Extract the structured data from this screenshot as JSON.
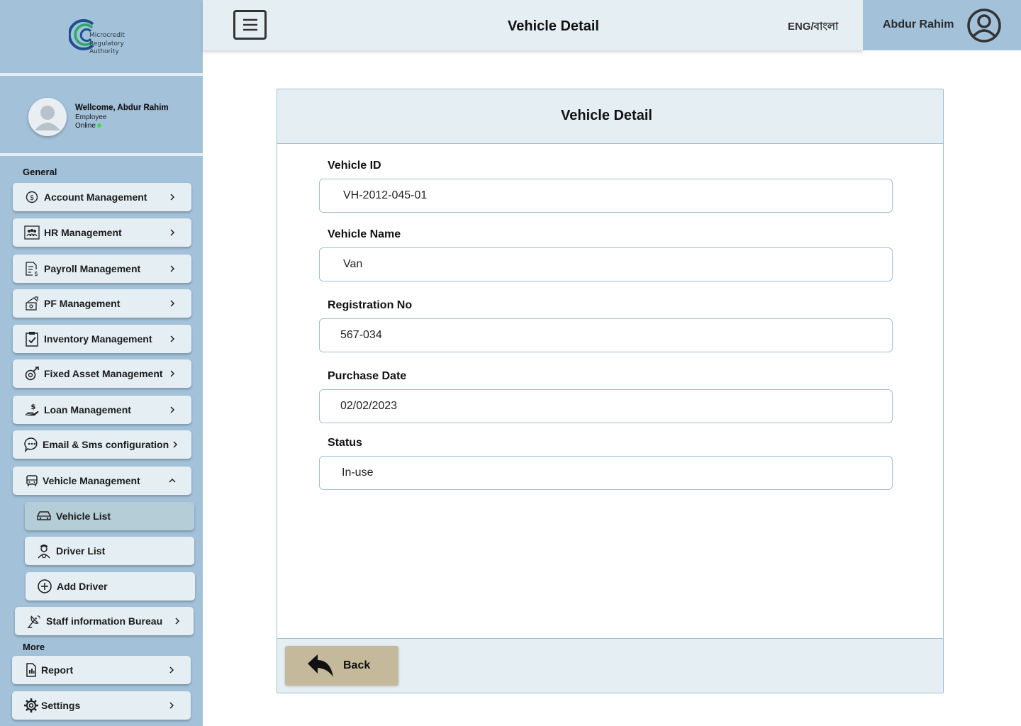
{
  "brand": {
    "logo_lines": [
      "Microcredit",
      "Regulatory",
      "Authority"
    ]
  },
  "profile": {
    "welcome": "Wellcome, Abdur Rahim",
    "role": "Employee",
    "status": "Online"
  },
  "sidebar": {
    "general_label": "General",
    "more_label": "More",
    "items": [
      {
        "label": "Account Management",
        "icon": "dollar-circle-icon"
      },
      {
        "label": "HR Management",
        "icon": "people-icon"
      },
      {
        "label": "Payroll Management",
        "icon": "payroll-doc-icon"
      },
      {
        "label": "PF Management",
        "icon": "fund-icon"
      },
      {
        "label": "Inventory Management",
        "icon": "clipboard-check-icon"
      },
      {
        "label": "Fixed Asset Management",
        "icon": "asset-icon"
      },
      {
        "label": "Loan Management",
        "icon": "hand-money-icon"
      },
      {
        "label": "Email & Sms configuration",
        "icon": "chat-bubble-icon"
      },
      {
        "label": "Vehicle Management",
        "icon": "bus-icon"
      }
    ],
    "sub_items": [
      {
        "label": "Vehicle List",
        "icon": "car-icon"
      },
      {
        "label": "Driver List",
        "icon": "driver-icon"
      },
      {
        "label": "Add Driver",
        "icon": "plus-circle-icon"
      }
    ],
    "extra_item": {
      "label": "Staff information Bureau",
      "icon": "satellite-icon"
    },
    "more_items": [
      {
        "label": "Report",
        "icon": "report-icon"
      },
      {
        "label": "Settings",
        "icon": "gear-icon"
      }
    ]
  },
  "header": {
    "title": "Vehicle Detail",
    "language": "ENG/বাংলা",
    "user_name": "Abdur Rahim"
  },
  "card": {
    "title": "Vehicle Detail",
    "fields": [
      {
        "label": "Vehicle ID",
        "value": "VH-2012-045-01"
      },
      {
        "label": "Vehicle Name",
        "value": "Van"
      },
      {
        "label": "Registration No",
        "value": "567-034"
      },
      {
        "label": "Purchase Date",
        "value": "02/02/2023"
      },
      {
        "label": "Status",
        "value": "In-use"
      }
    ],
    "back_label": "Back"
  },
  "colors": {
    "sidebar": "#a3c1d9",
    "panel": "#e4eef3",
    "active": "#b5cdd6",
    "back_button": "#c5b99b",
    "border": "#9fc0d3"
  }
}
